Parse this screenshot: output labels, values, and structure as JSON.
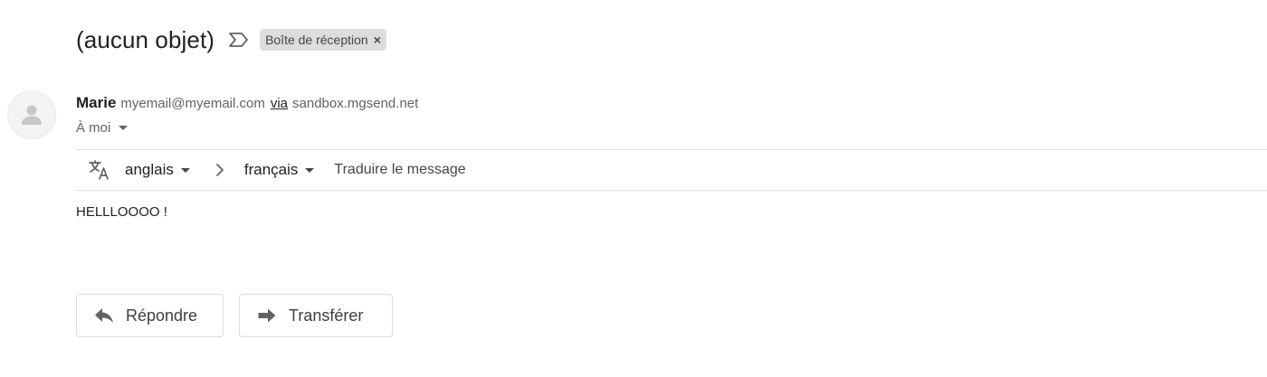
{
  "message": {
    "subject": "(aucun objet)",
    "importance_icon": "importance-marker-icon",
    "label": "Boîte de réception",
    "label_remove": "×"
  },
  "sender": {
    "avatar_icon": "person-silhouette-icon",
    "name": "Marie",
    "email": "myemail@myemail.com",
    "via": "via",
    "domain": "sandbox.mgsend.net"
  },
  "recipient": {
    "label": "À moi"
  },
  "translation": {
    "icon": "translate-icon",
    "from_language": "anglais",
    "to_language": "français",
    "action": "Traduire le message"
  },
  "body": {
    "text": "HELLLOOOO !"
  },
  "actions": {
    "reply_label": "Répondre",
    "reply_icon": "reply-arrow-icon",
    "forward_label": "Transférer",
    "forward_icon": "forward-arrow-icon"
  },
  "colors": {
    "chip_background": "#dddddd",
    "secondary_text": "#5f6368",
    "divider": "#e0e0e0",
    "button_border": "#dadce0"
  }
}
